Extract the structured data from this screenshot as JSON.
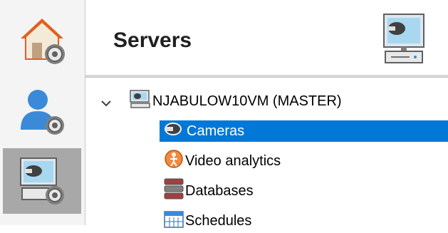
{
  "sidebar": {
    "items": [
      {
        "name": "home-settings",
        "icon": "home-gear-icon"
      },
      {
        "name": "user-settings",
        "icon": "user-gear-icon"
      },
      {
        "name": "server-settings",
        "icon": "server-gear-icon",
        "active": true
      }
    ]
  },
  "header": {
    "title": "Servers",
    "icon": "server-monitor-icon"
  },
  "tree": {
    "root": {
      "label": "NJABULOW10VM (MASTER)",
      "icon": "server-icon",
      "expanded": true
    },
    "children": [
      {
        "label": "Cameras",
        "icon": "camera-icon",
        "selected": true
      },
      {
        "label": "Video analytics",
        "icon": "video-analytics-icon"
      },
      {
        "label": "Databases",
        "icon": "database-icon"
      },
      {
        "label": "Schedules",
        "icon": "schedule-icon"
      }
    ]
  },
  "colors": {
    "selection": "#0078d7",
    "sidebar_active": "#a8a8a8"
  }
}
